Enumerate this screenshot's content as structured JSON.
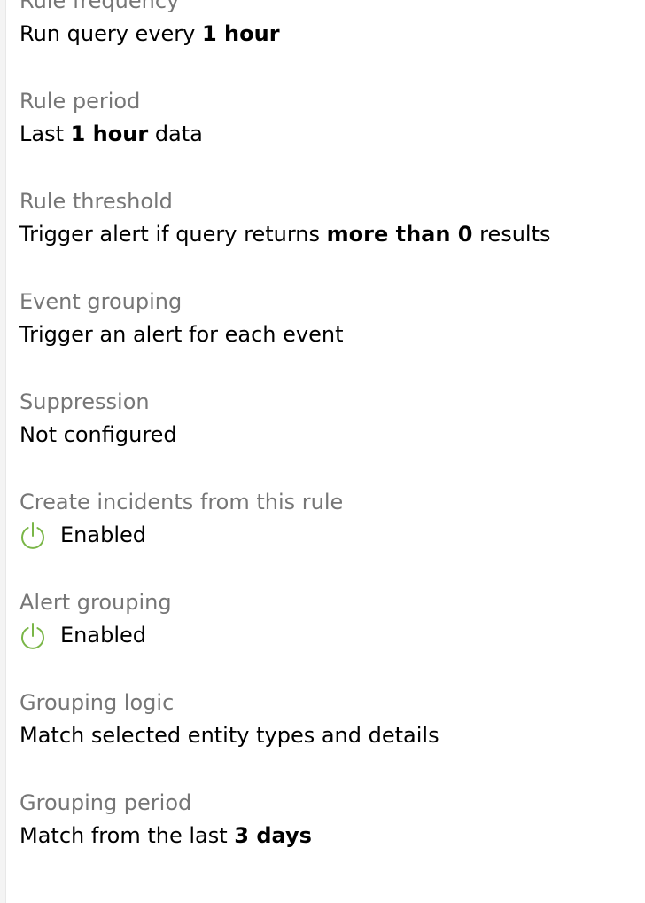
{
  "fields": {
    "rule_frequency": {
      "label": "Rule frequency",
      "value_prefix": "Run query every ",
      "value_strong": "1 hour",
      "value_suffix": ""
    },
    "rule_period": {
      "label": "Rule period",
      "value_prefix": "Last ",
      "value_strong": "1 hour",
      "value_suffix": " data"
    },
    "rule_threshold": {
      "label": "Rule threshold",
      "value_prefix": "Trigger alert if query returns ",
      "value_strong": "more than 0",
      "value_suffix": " results"
    },
    "event_grouping": {
      "label": "Event grouping",
      "value": "Trigger an alert for each event"
    },
    "suppression": {
      "label": "Suppression",
      "value": "Not configured"
    },
    "create_incidents": {
      "label": "Create incidents from this rule",
      "status": "Enabled",
      "icon": "power-icon",
      "icon_color": "#7ab648"
    },
    "alert_grouping": {
      "label": "Alert grouping",
      "status": "Enabled",
      "icon": "power-icon",
      "icon_color": "#7ab648"
    },
    "grouping_logic": {
      "label": "Grouping logic",
      "value": "Match selected entity types and details"
    },
    "grouping_period": {
      "label": "Grouping period",
      "value_prefix": "Match from the last ",
      "value_strong": "3 days",
      "value_suffix": ""
    }
  }
}
